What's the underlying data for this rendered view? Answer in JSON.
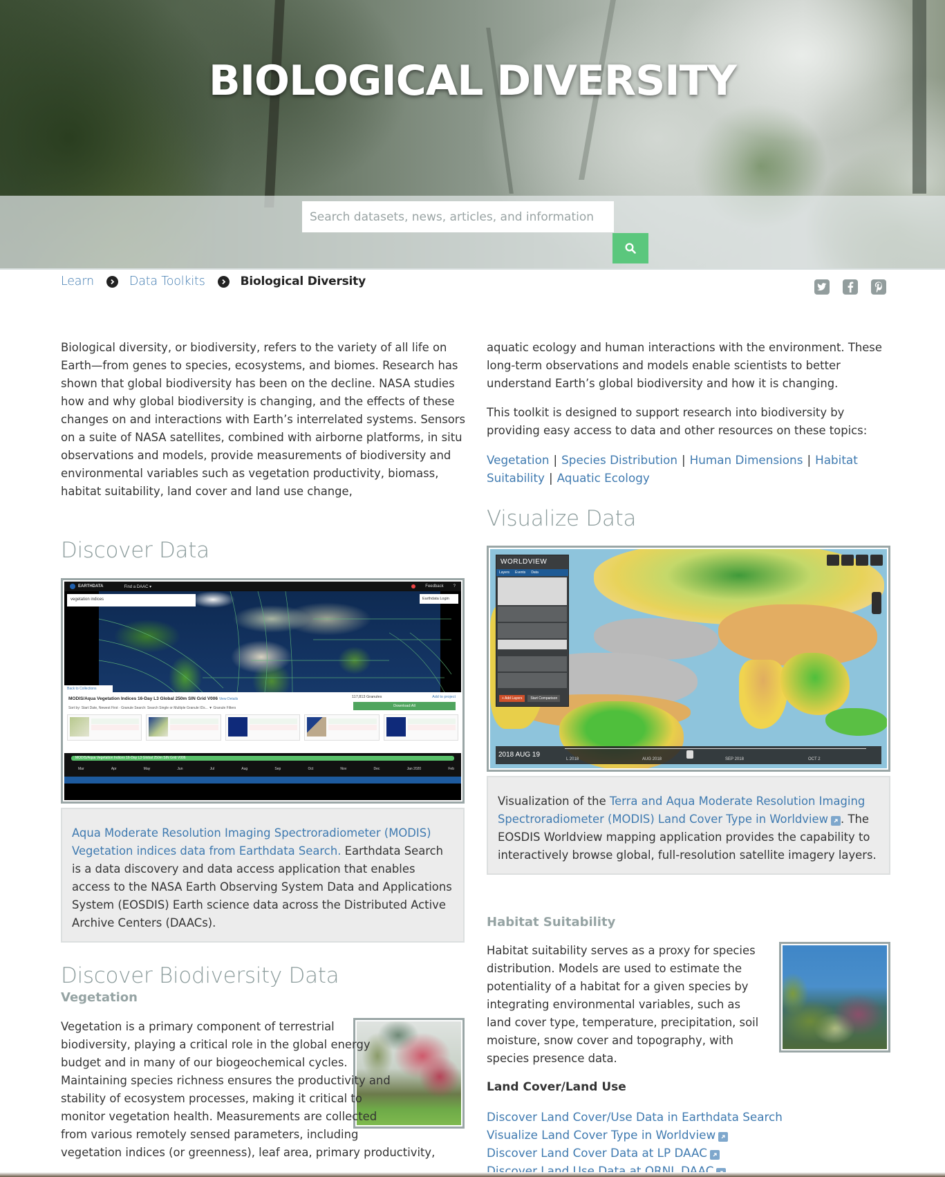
{
  "hero": {
    "title": "BIOLOGICAL DIVERSITY",
    "search_placeholder": "Search datasets, news, articles, and information",
    "search_button_icon": "search-icon",
    "accent_color": "#5bc77d"
  },
  "breadcrumb": {
    "items": [
      {
        "label": "Learn"
      },
      {
        "label": "Data Toolkits"
      }
    ],
    "current": "Biological Diversity"
  },
  "social": [
    "twitter-icon",
    "facebook-icon",
    "pinterest-icon"
  ],
  "intro": {
    "left_paragraph": "Biological diversity, or biodiversity, refers to the variety of all life on Earth—from genes to species, ecosystems, and biomes. Research has shown that global biodiversity has been on the decline. NASA studies how and why global biodiversity is changing, and the effects of these changes on and interactions with Earth’s interrelated systems. Sensors on a suite of NASA satellites, combined with airborne platforms, in situ observations and models, provide measurements of biodiversity and environmental variables such as vegetation productivity, biomass, habitat suitability, land cover and land use change,",
    "right_paragraph_1": "aquatic ecology and human interactions with the environment. These long-term observations and models enable scientists to better understand Earth’s global biodiversity and how it is changing.",
    "right_paragraph_2": "This toolkit is designed to support research into biodiversity by providing easy access to data and other resources on these topics:",
    "topic_links": [
      "Vegetation",
      "Species Distribution",
      "Human Dimensions",
      "Habitat Suitability",
      "Aquatic Ecology"
    ],
    "separator": "|"
  },
  "discover_data": {
    "title": "Discover Data",
    "screenshot": {
      "brand": "EARTHDATA",
      "find_daac": "Find a DAAC ▾",
      "feedback": "Feedback",
      "search_value": "vegetation indices",
      "login": "Earthdata Login",
      "back": "Back to Collections",
      "collection_title": "MODIS/Aqua Vegetation Indices 16-Day L3 Global 250m SIN Grid V006",
      "view_details": "View Details",
      "sort_label": "Sort by: Start Date, Newest First · Granule Search: Search Single or Multiple Granule IDs...  ▼ Granule Filters",
      "granules": "117,813 Granules",
      "add_to_project": "Add to project",
      "download_all": "Download All",
      "timeline_bar": "MODIS/Aqua Vegetation Indices 16-Day L3 Global 250m SIN Grid V006",
      "months": [
        "Mar",
        "Apr",
        "May",
        "Jun",
        "Jul",
        "Aug",
        "Sep",
        "Oct",
        "Nov",
        "Dec",
        "Jan 2020",
        "Feb"
      ]
    },
    "caption_link": "Aqua Moderate Resolution Imaging Spectroradiometer (MODIS) Vegetation indices data from Earthdata Search.",
    "caption_text": " Earthdata Search is a data discovery and data access application that enables access to the NASA Earth Observing System Data and Applications System (EOSDIS) Earth science data across the Distributed Active Archive Centers (DAACs)."
  },
  "visualize_data": {
    "title": "Visualize Data",
    "screenshot": {
      "app": "WORLDVIEW",
      "tabs": [
        "Layers",
        "Events",
        "Data"
      ],
      "add_layers": "+ Add Layers",
      "start_comparison": "Start Comparison",
      "date": "2018 AUG 19",
      "month_labels": [
        "L 2018",
        "AUG 2018",
        "SEP 2018",
        "OCT 2"
      ]
    },
    "caption_prefix": "Visualization of the ",
    "caption_link": "Terra and Aqua Moderate Resolution Imaging Spectroradiometer (MODIS) Land Cover Type in Worldview",
    "caption_suffix": ". The EOSDIS Worldview mapping application provides the capability to interactively browse global, full-resolution satellite imagery layers."
  },
  "biodiversity": {
    "title": "Discover Biodiversity Data",
    "vegetation": {
      "heading": "Vegetation",
      "text": "Vegetation is a primary component of terrestrial biodiversity, playing a critical role in the global energy budget and in many of our biogeochemical cycles. Maintaining species richness ensures the productivity and stability of ecosystem processes, making it critical to monitor vegetation health. Measurements are collected from various remotely sensed parameters, including vegetation indices (or greenness), leaf area, primary productivity,"
    },
    "habitat": {
      "heading": "Habitat Suitability",
      "text": "Habitat suitability serves as a proxy for species distribution. Models are used to estimate the potentiality of a habitat for a given species by integrating environmental variables, such as land cover type, temperature, precipitation, soil moisture, snow cover and topography, with species presence data."
    },
    "land_cover": {
      "heading": "Land Cover/Land Use",
      "links": [
        {
          "label": "Discover Land Cover/Use Data in Earthdata Search",
          "external": false
        },
        {
          "label": "Visualize Land Cover Type in Worldview",
          "external": true
        },
        {
          "label": "Discover Land Cover Data at LP DAAC",
          "external": true
        },
        {
          "label": "Discover Land Use Data at ORNL DAAC",
          "external": true
        }
      ]
    }
  },
  "colors": {
    "link": "#3f7ab0",
    "heading_gray": "#8c9c9c",
    "frame_border": "#9aa6a6",
    "caption_bg": "#ececec"
  }
}
